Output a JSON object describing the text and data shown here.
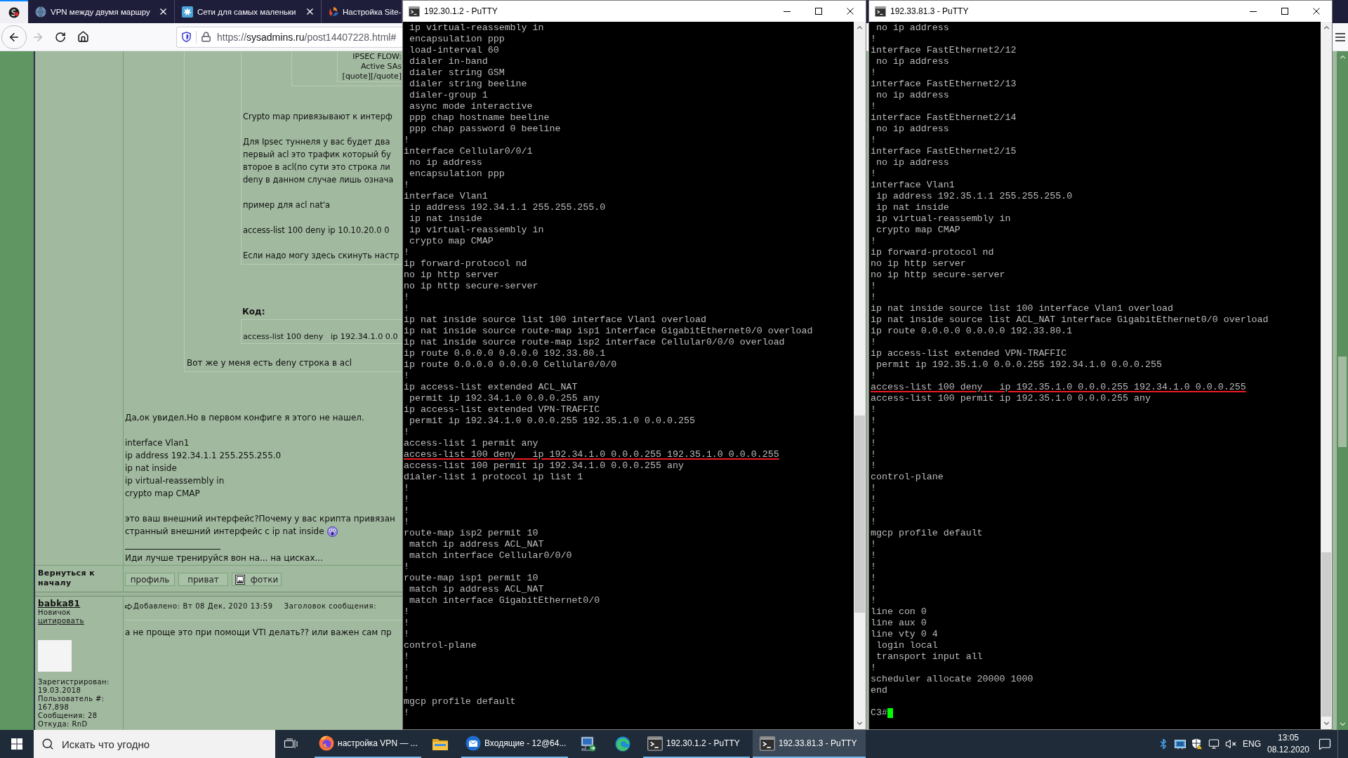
{
  "browser": {
    "tabs": [
      {
        "selected": true
      },
      {
        "label": "VPN между двумя маршру",
        "selected": false
      },
      {
        "label": "Сети для самых маленьки",
        "selected": false
      },
      {
        "label": "Настройка Site-",
        "selected": false
      }
    ],
    "forward_disabled": true,
    "url": {
      "scheme": "https://",
      "host": "sysadmins.ru",
      "path": "/post14407228.html#"
    },
    "forum": {
      "nested_quote": [
        "IPSEC FLOW:",
        "Active SAs",
        "[quote][/quote]"
      ],
      "quote_paragraphs": [
        [
          "Crypto map привязывают к интерф"
        ],
        [
          "Для Ipsec туннеля у вас будет два",
          "первый acl это трафик который бу",
          "второе в acl(по сути это строка ли",
          "deny в данном случае лишь означа"
        ],
        [
          "пример для acl nat'a"
        ],
        [
          "access-list 100 deny ip 10.10.20.0 0"
        ],
        [
          "Если надо могу здесь скинуть настр"
        ]
      ],
      "code_label": "Код:",
      "code": "access-list 100 deny   ip 192.34.1.0 0.0",
      "reply": "Вот же у меня есть deny строка в acl",
      "paragraphs": [
        [
          "Да,ок увидел.Но в первом конфиге я этого не нашел."
        ],
        [
          "interface Vlan1",
          "ip address 192.34.1.1 255.255.255.0",
          "ip nat inside",
          "ip virtual-reassembly in",
          "crypto map CMAP"
        ],
        [
          "это ваш внешний интерфейс?Почему у вас крипта привязан",
          "странный внешний интерфейс с ip nat inside"
        ]
      ],
      "signature": "Иди лучше тренируйся вон на... на цисках...",
      "back_to_top": "Вернуться к началу",
      "profile_buttons": [
        "профиль",
        "приват",
        "фотки"
      ],
      "next_post": {
        "author": "babka81",
        "rank": "Новичок",
        "quote_link": "цитировать",
        "profile_info": [
          "Зарегистрирован: 19.03.2018",
          "Пользователь #: 167,898",
          "Сообщения: 28",
          "Откуда: RnD"
        ],
        "posted": "Добавлено: Вт 08 Дек, 2020 13:59",
        "subject_label": "Заголовок сообщения:",
        "body": "а не проще это при помощи VTI делать?? или важен сам пр"
      }
    }
  },
  "putty_windows": [
    {
      "title": "192.30.1.2 - PuTTY",
      "lines": [
        {
          "text": " ip virtual-reassembly in",
          "underlined": false
        },
        {
          "text": " encapsulation ppp",
          "underlined": false
        },
        {
          "text": " load-interval 60",
          "underlined": false
        },
        {
          "text": " dialer in-band",
          "underlined": false
        },
        {
          "text": " dialer string GSM",
          "underlined": false
        },
        {
          "text": " dialer string beeline",
          "underlined": false
        },
        {
          "text": " dialer-group 1",
          "underlined": false
        },
        {
          "text": " async mode interactive",
          "underlined": false
        },
        {
          "text": " ppp chap hostname beeline",
          "underlined": false
        },
        {
          "text": " ppp chap password 0 beeline",
          "underlined": false
        },
        {
          "text": "!",
          "underlined": false
        },
        {
          "text": "interface Cellular0/0/1",
          "underlined": false
        },
        {
          "text": " no ip address",
          "underlined": false
        },
        {
          "text": " encapsulation ppp",
          "underlined": false
        },
        {
          "text": "!",
          "underlined": false
        },
        {
          "text": "interface Vlan1",
          "underlined": false
        },
        {
          "text": " ip address 192.34.1.1 255.255.255.0",
          "underlined": false
        },
        {
          "text": " ip nat inside",
          "underlined": false
        },
        {
          "text": " ip virtual-reassembly in",
          "underlined": false
        },
        {
          "text": " crypto map CMAP",
          "underlined": false
        },
        {
          "text": "!",
          "underlined": false
        },
        {
          "text": "ip forward-protocol nd",
          "underlined": false
        },
        {
          "text": "no ip http server",
          "underlined": false
        },
        {
          "text": "no ip http secure-server",
          "underlined": false
        },
        {
          "text": "!",
          "underlined": false
        },
        {
          "text": "!",
          "underlined": false
        },
        {
          "text": "ip nat inside source list 100 interface Vlan1 overload",
          "underlined": false
        },
        {
          "text": "ip nat inside source route-map isp1 interface GigabitEthernet0/0 overload",
          "underlined": false
        },
        {
          "text": "ip nat inside source route-map isp2 interface Cellular0/0/0 overload",
          "underlined": false
        },
        {
          "text": "ip route 0.0.0.0 0.0.0.0 192.33.80.1",
          "underlined": false
        },
        {
          "text": "ip route 0.0.0.0 0.0.0.0 Cellular0/0/0",
          "underlined": false
        },
        {
          "text": "!",
          "underlined": false
        },
        {
          "text": "ip access-list extended ACL_NAT",
          "underlined": false
        },
        {
          "text": " permit ip 192.34.1.0 0.0.0.255 any",
          "underlined": false
        },
        {
          "text": "ip access-list extended VPN-TRAFFIC",
          "underlined": false
        },
        {
          "text": " permit ip 192.34.1.0 0.0.0.255 192.35.1.0 0.0.0.255",
          "underlined": false
        },
        {
          "text": "!",
          "underlined": false
        },
        {
          "text": "access-list 1 permit any",
          "underlined": false
        },
        {
          "text": "access-list 100 deny   ip 192.34.1.0 0.0.0.255 192.35.1.0 0.0.0.255",
          "underlined": true
        },
        {
          "text": "access-list 100 permit ip 192.34.1.0 0.0.0.255 any",
          "underlined": false
        },
        {
          "text": "dialer-list 1 protocol ip list 1",
          "underlined": false
        },
        {
          "text": "!",
          "underlined": false
        },
        {
          "text": "!",
          "underlined": false
        },
        {
          "text": "!",
          "underlined": false
        },
        {
          "text": "!",
          "underlined": false
        },
        {
          "text": "route-map isp2 permit 10",
          "underlined": false
        },
        {
          "text": " match ip address ACL_NAT",
          "underlined": false
        },
        {
          "text": " match interface Cellular0/0/0",
          "underlined": false
        },
        {
          "text": "!",
          "underlined": false
        },
        {
          "text": "route-map isp1 permit 10",
          "underlined": false
        },
        {
          "text": " match ip address ACL_NAT",
          "underlined": false
        },
        {
          "text": " match interface GigabitEthernet0/0",
          "underlined": false
        },
        {
          "text": "!",
          "underlined": false
        },
        {
          "text": "!",
          "underlined": false
        },
        {
          "text": "!",
          "underlined": false
        },
        {
          "text": "control-plane",
          "underlined": false
        },
        {
          "text": "!",
          "underlined": false
        },
        {
          "text": "!",
          "underlined": false
        },
        {
          "text": "!",
          "underlined": false
        },
        {
          "text": "!",
          "underlined": false
        },
        {
          "text": "mgcp profile default",
          "underlined": false
        },
        {
          "text": "!",
          "underlined": false
        }
      ]
    },
    {
      "title": "192.33.81.3 - PuTTY",
      "lines": [
        {
          "text": " no ip address",
          "underlined": false
        },
        {
          "text": "!",
          "underlined": false
        },
        {
          "text": "interface FastEthernet2/12",
          "underlined": false
        },
        {
          "text": " no ip address",
          "underlined": false
        },
        {
          "text": "!",
          "underlined": false
        },
        {
          "text": "interface FastEthernet2/13",
          "underlined": false
        },
        {
          "text": " no ip address",
          "underlined": false
        },
        {
          "text": "!",
          "underlined": false
        },
        {
          "text": "interface FastEthernet2/14",
          "underlined": false
        },
        {
          "text": " no ip address",
          "underlined": false
        },
        {
          "text": "!",
          "underlined": false
        },
        {
          "text": "interface FastEthernet2/15",
          "underlined": false
        },
        {
          "text": " no ip address",
          "underlined": false
        },
        {
          "text": "!",
          "underlined": false
        },
        {
          "text": "interface Vlan1",
          "underlined": false
        },
        {
          "text": " ip address 192.35.1.1 255.255.255.0",
          "underlined": false
        },
        {
          "text": " ip nat inside",
          "underlined": false
        },
        {
          "text": " ip virtual-reassembly in",
          "underlined": false
        },
        {
          "text": " crypto map CMAP",
          "underlined": false
        },
        {
          "text": "!",
          "underlined": false
        },
        {
          "text": "ip forward-protocol nd",
          "underlined": false
        },
        {
          "text": "no ip http server",
          "underlined": false
        },
        {
          "text": "no ip http secure-server",
          "underlined": false
        },
        {
          "text": "!",
          "underlined": false
        },
        {
          "text": "!",
          "underlined": false
        },
        {
          "text": "ip nat inside source list 100 interface Vlan1 overload",
          "underlined": false
        },
        {
          "text": "ip nat inside source list ACL_NAT interface GigabitEthernet0/0 overload",
          "underlined": false
        },
        {
          "text": "ip route 0.0.0.0 0.0.0.0 192.33.80.1",
          "underlined": false
        },
        {
          "text": "!",
          "underlined": false
        },
        {
          "text": "ip access-list extended VPN-TRAFFIC",
          "underlined": false
        },
        {
          "text": " permit ip 192.35.1.0 0.0.0.255 192.34.1.0 0.0.0.255",
          "underlined": false
        },
        {
          "text": "!",
          "underlined": false
        },
        {
          "text": "access-list 100 deny   ip 192.35.1.0 0.0.0.255 192.34.1.0 0.0.0.255",
          "underlined": true
        },
        {
          "text": "access-list 100 permit ip 192.35.1.0 0.0.0.255 any",
          "underlined": false
        },
        {
          "text": "!",
          "underlined": false
        },
        {
          "text": "!",
          "underlined": false
        },
        {
          "text": "!",
          "underlined": false
        },
        {
          "text": "!",
          "underlined": false
        },
        {
          "text": "!",
          "underlined": false
        },
        {
          "text": "!",
          "underlined": false
        },
        {
          "text": "control-plane",
          "underlined": false
        },
        {
          "text": "!",
          "underlined": false
        },
        {
          "text": "!",
          "underlined": false
        },
        {
          "text": "!",
          "underlined": false
        },
        {
          "text": "!",
          "underlined": false
        },
        {
          "text": "mgcp profile default",
          "underlined": false
        },
        {
          "text": "!",
          "underlined": false
        },
        {
          "text": "!",
          "underlined": false
        },
        {
          "text": "!",
          "underlined": false
        },
        {
          "text": "!",
          "underlined": false
        },
        {
          "text": "!",
          "underlined": false
        },
        {
          "text": "!",
          "underlined": false
        },
        {
          "text": "line con 0",
          "underlined": false
        },
        {
          "text": "line aux 0",
          "underlined": false
        },
        {
          "text": "line vty 0 4",
          "underlined": false
        },
        {
          "text": " login local",
          "underlined": false
        },
        {
          "text": " transport input all",
          "underlined": false
        },
        {
          "text": "!",
          "underlined": false
        },
        {
          "text": "scheduler allocate 20000 1000",
          "underlined": false
        },
        {
          "text": "end",
          "underlined": false
        }
      ],
      "prompt": "C3#",
      "cursor": true
    }
  ],
  "taskbar": {
    "search_placeholder": "Искать что угодно",
    "apps": [
      {
        "label": "настройка VPN — ...",
        "selected": false
      },
      {
        "label": "Входящие - 12@64...",
        "selected": false
      },
      {
        "label": "192.30.1.2 - PuTTY",
        "selected": false
      },
      {
        "label": "192.33.81.3 - PuTTY",
        "selected": true
      }
    ],
    "language": "ENG",
    "time": "13:05",
    "date": "08.12.2020"
  }
}
